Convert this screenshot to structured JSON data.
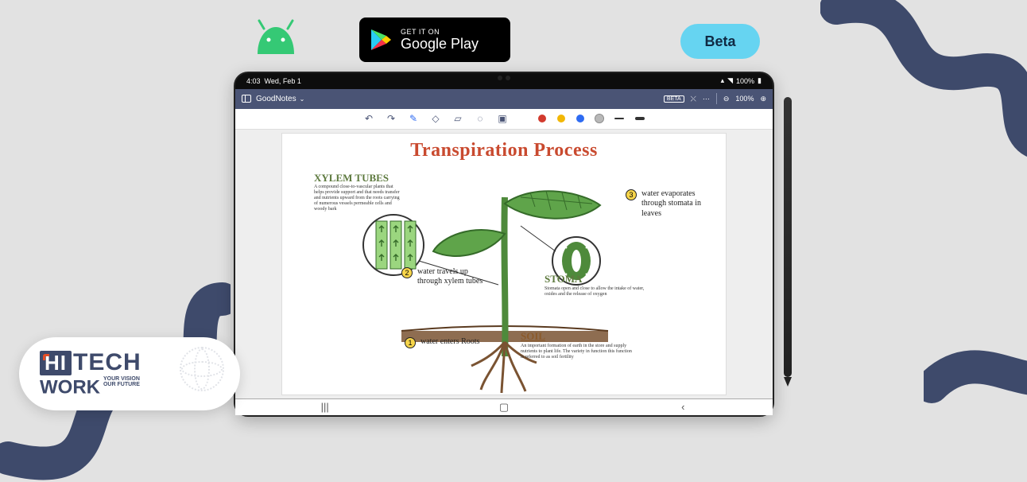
{
  "play_badge": {
    "line1": "GET IT ON",
    "line2": "Google Play"
  },
  "beta_badge": "Beta",
  "status": {
    "time": "4:03",
    "date": "Wed, Feb 1",
    "battery": "100%"
  },
  "appbar": {
    "title": "GoodNotes",
    "beta_tag": "BETA",
    "zoom": "100%"
  },
  "toolbar": {
    "colors": {
      "red": "#D23A2E",
      "yellow": "#F2B705",
      "blue": "#2E6BF2",
      "gray": "#B8B8B8"
    }
  },
  "page": {
    "title": "Transpiration Process",
    "xylem": "XYLEM TUBES",
    "stoma": "STOMA",
    "soil": "SOIL",
    "xylem_note": "A compound close-to-vascular plants that helps provide support and that needs transfer and nutrients upward from the roots carrying of numerous vessels permeable cells and woody bark",
    "stoma_note": "Stomata open and close to allow the intake of water, oxides and the release of oxygen",
    "soil_note": "An important formation of earth in the store and supply nutrients to plant life. The variety in function this function is referred to as soil fertility",
    "step1": "water enters Roots",
    "step2": "water travels up through xylem tubes",
    "step3": "water evaporates through stomata in leaves"
  },
  "logo": {
    "hi": "HI",
    "tech": "TECH",
    "work": "WORK",
    "tag1": "YOUR VISION",
    "tag2": "OUR FUTURE"
  }
}
